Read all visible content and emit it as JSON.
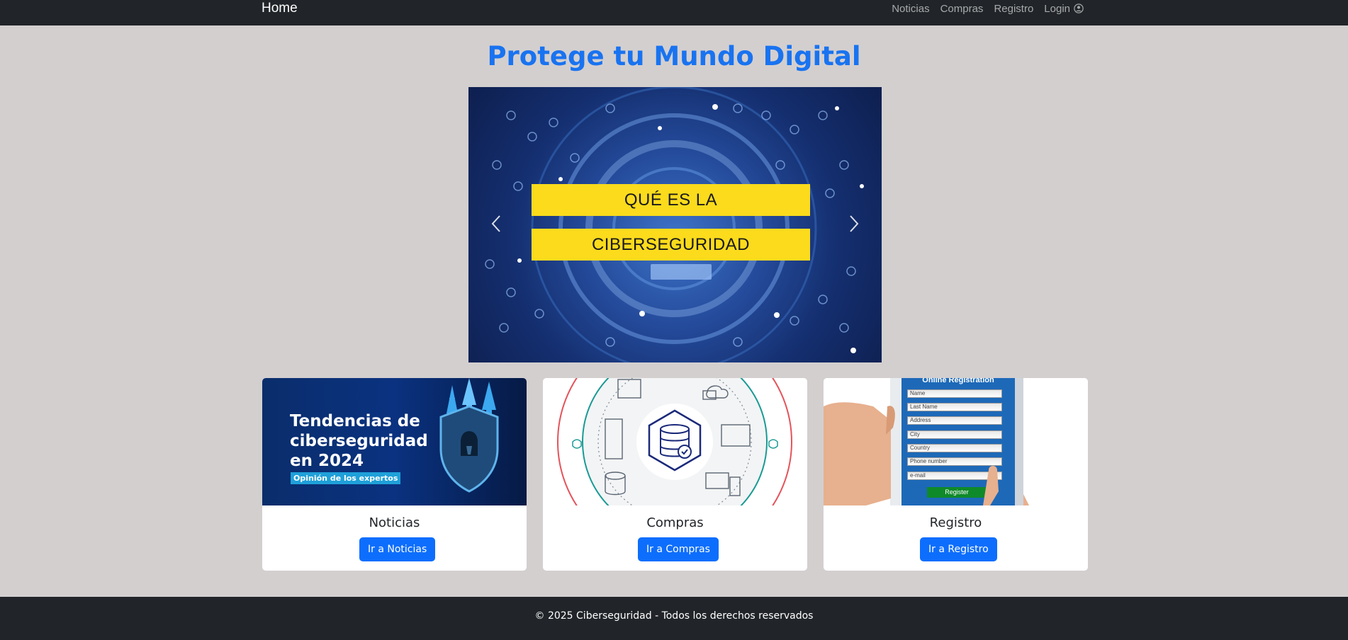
{
  "navbar": {
    "brand": "Home",
    "links": [
      {
        "label": "Noticias"
      },
      {
        "label": "Compras"
      },
      {
        "label": "Registro"
      },
      {
        "label": "Login",
        "icon": "user-circle-icon"
      }
    ]
  },
  "hero": {
    "title": "Protege tu Mundo Digital"
  },
  "carousel": {
    "slide_line_1": "QUÉ ES LA",
    "slide_line_2": "CIBERSEGURIDAD",
    "prev_icon": "chevron-left-icon",
    "next_icon": "chevron-right-icon"
  },
  "cards": [
    {
      "title": "Noticias",
      "button": "Ir a Noticias",
      "image_text": "Tendencias de ciberseguridad en 2024",
      "image_tag": "Opinión de los expertos"
    },
    {
      "title": "Compras",
      "button": "Ir a Compras"
    },
    {
      "title": "Registro",
      "button": "Ir a Registro",
      "image_heading": "Online Registration",
      "image_fields": [
        "Name",
        "Last Name",
        "Address",
        "City",
        "Country",
        "Phone number",
        "e-mail"
      ],
      "image_button": "Register"
    }
  ],
  "footer": {
    "text": "© 2025 Ciberseguridad - Todos los derechos reservados"
  },
  "colors": {
    "navbar_bg": "#212529",
    "page_bg": "#d3cfcf",
    "title": "#1973f0",
    "button": "#0d6efd",
    "banner": "#fbdb1c"
  }
}
